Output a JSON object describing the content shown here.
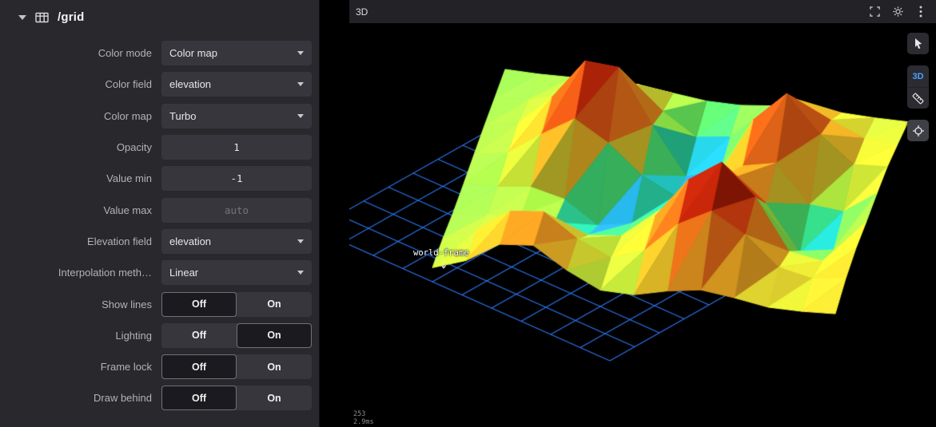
{
  "sidebar": {
    "title": "/grid",
    "rows": [
      {
        "id": "color-mode",
        "label": "Color mode",
        "type": "select",
        "value": "Color map"
      },
      {
        "id": "color-field",
        "label": "Color field",
        "type": "select",
        "value": "elevation"
      },
      {
        "id": "color-map",
        "label": "Color map",
        "type": "select",
        "value": "Turbo"
      },
      {
        "id": "opacity",
        "label": "Opacity",
        "type": "input",
        "value": "1",
        "placeholder": ""
      },
      {
        "id": "value-min",
        "label": "Value min",
        "type": "input",
        "value": "-1",
        "placeholder": ""
      },
      {
        "id": "value-max",
        "label": "Value max",
        "type": "input",
        "value": "",
        "placeholder": "auto"
      },
      {
        "id": "elevation-field",
        "label": "Elevation field",
        "type": "select",
        "value": "elevation"
      },
      {
        "id": "interpolation-method",
        "label": "Interpolation meth…",
        "type": "select",
        "value": "Linear"
      },
      {
        "id": "show-lines",
        "label": "Show lines",
        "type": "toggle",
        "options": [
          "Off",
          "On"
        ],
        "selected": "Off"
      },
      {
        "id": "lighting",
        "label": "Lighting",
        "type": "toggle",
        "options": [
          "Off",
          "On"
        ],
        "selected": "On"
      },
      {
        "id": "frame-lock",
        "label": "Frame lock",
        "type": "toggle",
        "options": [
          "Off",
          "On"
        ],
        "selected": "Off"
      },
      {
        "id": "draw-behind",
        "label": "Draw behind",
        "type": "toggle",
        "options": [
          "Off",
          "On"
        ],
        "selected": "Off"
      }
    ]
  },
  "viewport": {
    "panel_title": "3D",
    "frame_label": "world-frame",
    "render_stats": [
      "253",
      "2.9ms"
    ],
    "perspective_button_label": "3D",
    "colormap": "Turbo",
    "colors": {
      "grid_line": "#2e7dff",
      "accent_blue": "#49a1ff",
      "background": "#000000"
    }
  }
}
